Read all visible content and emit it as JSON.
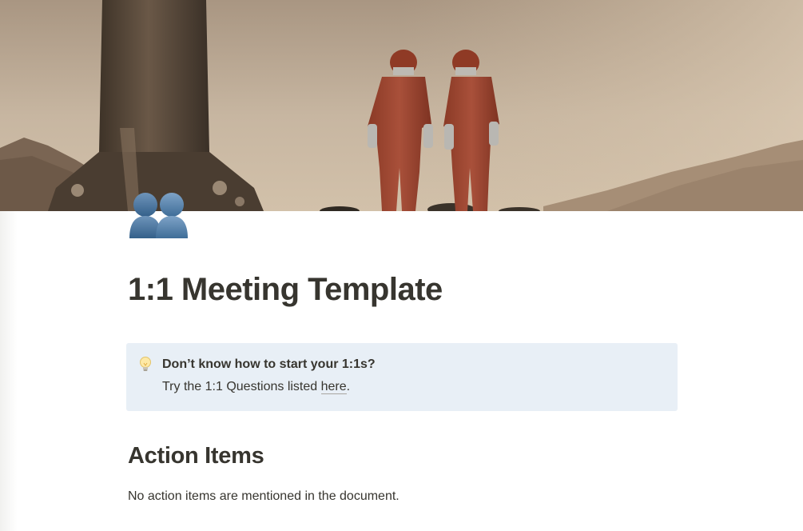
{
  "page": {
    "icon": "two-people-silhouette-icon",
    "title": "1:1 Meeting Template",
    "cover_image": "astronauts-red-suits-desert-rocket"
  },
  "callout": {
    "icon": "lightbulb-icon",
    "heading": "Don’t know how to start your 1:1s?",
    "text_before_link": "Try the 1:1 Questions listed ",
    "link_text": "here",
    "text_after_link": ".",
    "background_color": "#e8eff6"
  },
  "action_items": {
    "heading": "Action Items",
    "body": "No action items are mentioned in the document."
  }
}
